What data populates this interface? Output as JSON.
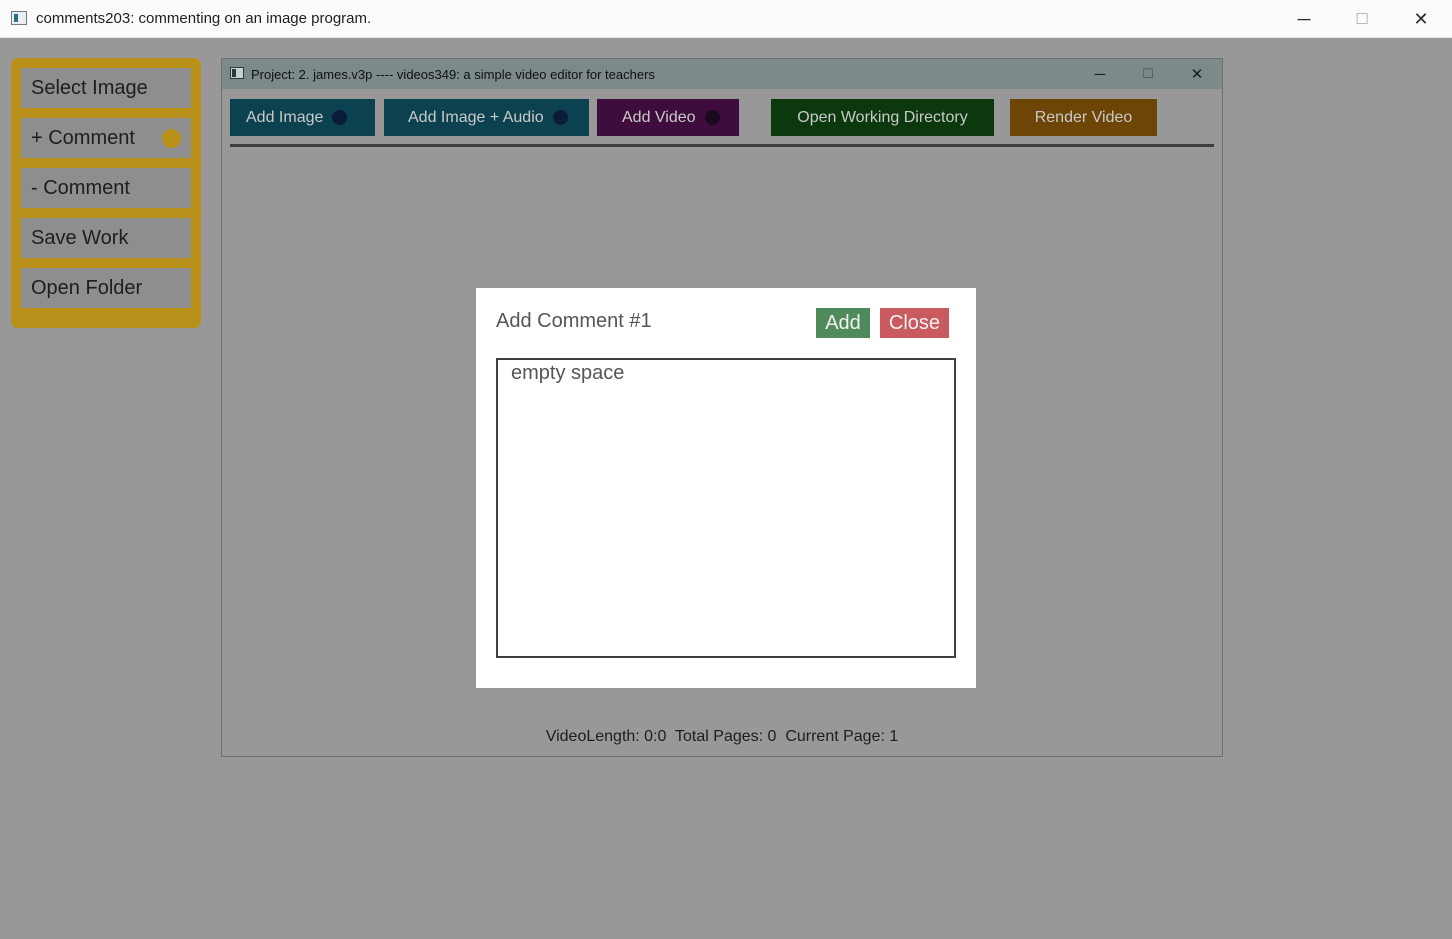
{
  "outer_window": {
    "title": "comments203: commenting on an image program.",
    "minimize_glyph": "─",
    "maximize_glyph": "☐",
    "close_glyph": "✕"
  },
  "side_panel": {
    "accent_color": "#b8901a",
    "buttons": [
      {
        "label": "Select Image"
      },
      {
        "label": "+ Comment",
        "indicator": true
      },
      {
        "label": "- Comment"
      },
      {
        "label": "Save Work"
      },
      {
        "label": "Open Folder"
      }
    ]
  },
  "inner_window": {
    "title": "Project: 2. james.v3p ---- videos349: a simple video editor for teachers",
    "minimize_glyph": "─",
    "maximize_glyph": "☐",
    "close_glyph": "✕",
    "toolbar": {
      "add_image": {
        "label": "Add Image",
        "color": "#0c4250",
        "dot_color": "#0a1c3a"
      },
      "add_image_audio": {
        "label": "Add Image + Audio",
        "color": "#0c4250",
        "dot_color": "#0a1c3a"
      },
      "add_video": {
        "label": "Add Video",
        "color": "#3e0c3d",
        "dot_color": "#1a0a1e"
      },
      "open_working_directory": {
        "label": "Open Working Directory",
        "color": "#0b380c"
      },
      "render_video": {
        "label": "Render Video",
        "color": "#6d4607"
      }
    },
    "status": "VideoLength: 0:0  Total Pages: 0  Current Page: 1"
  },
  "dialog": {
    "title": "Add Comment #1",
    "add_label": "Add",
    "add_color": "#4f8a5b",
    "close_label": "Close",
    "close_color": "#c95b60",
    "comment_text": "empty space"
  }
}
